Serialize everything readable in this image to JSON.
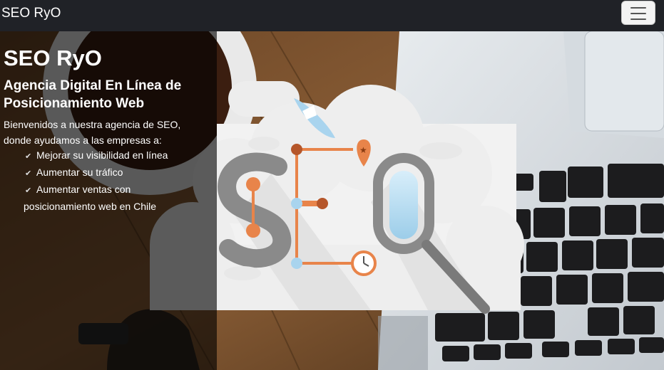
{
  "navbar": {
    "brand": "SEO RyO",
    "toggle_icon": "menu-icon"
  },
  "hero": {
    "title": "SEO RyO",
    "subtitle": "Agencia Digital En Línea de Posicionamiento Web",
    "intro": "Bienvenidos a nuestra agencia de SEO, donde ayudamos a las empresas a:",
    "benefits": [
      "Mejorar su visibilidad en línea",
      "Aumentar su tráfico",
      "Aumentar ventas con posicionamiento web en Chile"
    ],
    "check_icon": "check-icon",
    "illustration_text": "SEO",
    "colors": {
      "navbar": "#202227",
      "accent_orange": "#e8844a",
      "light_blue": "#a9d4ee"
    }
  }
}
